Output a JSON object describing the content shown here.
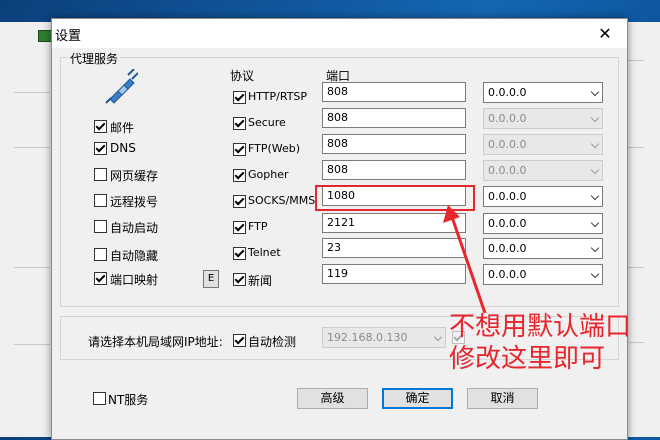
{
  "dialog": {
    "title": "设置",
    "close": "✕"
  },
  "proxy_group": {
    "label": "代理服务",
    "col_protocol": "协议",
    "col_port": "端口"
  },
  "services": [
    {
      "label": "邮件",
      "checked": true
    },
    {
      "label": "DNS",
      "checked": true
    },
    {
      "label": "网页缓存",
      "checked": false
    },
    {
      "label": "远程拨号",
      "checked": false
    },
    {
      "label": "自动启动",
      "checked": false
    },
    {
      "label": "自动隐藏",
      "checked": false
    },
    {
      "label": "端口映射",
      "checked": true
    }
  ],
  "e_button": "E",
  "protocols": [
    {
      "label": "HTTP/RTSP",
      "checked": true,
      "port": "808",
      "ip": "0.0.0.0",
      "enabled": true
    },
    {
      "label": "Secure",
      "checked": true,
      "port": "808",
      "ip": "0.0.0.0",
      "enabled": false
    },
    {
      "label": "FTP(Web)",
      "checked": true,
      "port": "808",
      "ip": "0.0.0.0",
      "enabled": false
    },
    {
      "label": "Gopher",
      "checked": true,
      "port": "808",
      "ip": "0.0.0.0",
      "enabled": false
    },
    {
      "label": "SOCKS/MMS",
      "checked": true,
      "port": "1080",
      "ip": "0.0.0.0",
      "enabled": true
    },
    {
      "label": "FTP",
      "checked": true,
      "port": "2121",
      "ip": "0.0.0.0",
      "enabled": true
    },
    {
      "label": "Telnet",
      "checked": true,
      "port": "23",
      "ip": "0.0.0.0",
      "enabled": true
    },
    {
      "label": "新闻",
      "checked": true,
      "port": "119",
      "ip": "0.0.0.0",
      "enabled": true
    }
  ],
  "local_ip": {
    "label": "请选择本机局域网IP地址:",
    "auto_detect_label": "自动检测",
    "auto_detect": true,
    "value": "192.168.0.130"
  },
  "footer": {
    "nt_service": "NT服务",
    "advanced": "高级",
    "ok": "确定",
    "cancel": "取消"
  },
  "annotation": {
    "line1": "不想用默认端口",
    "line2": "修改这里即可",
    "color": "#e8262e"
  }
}
